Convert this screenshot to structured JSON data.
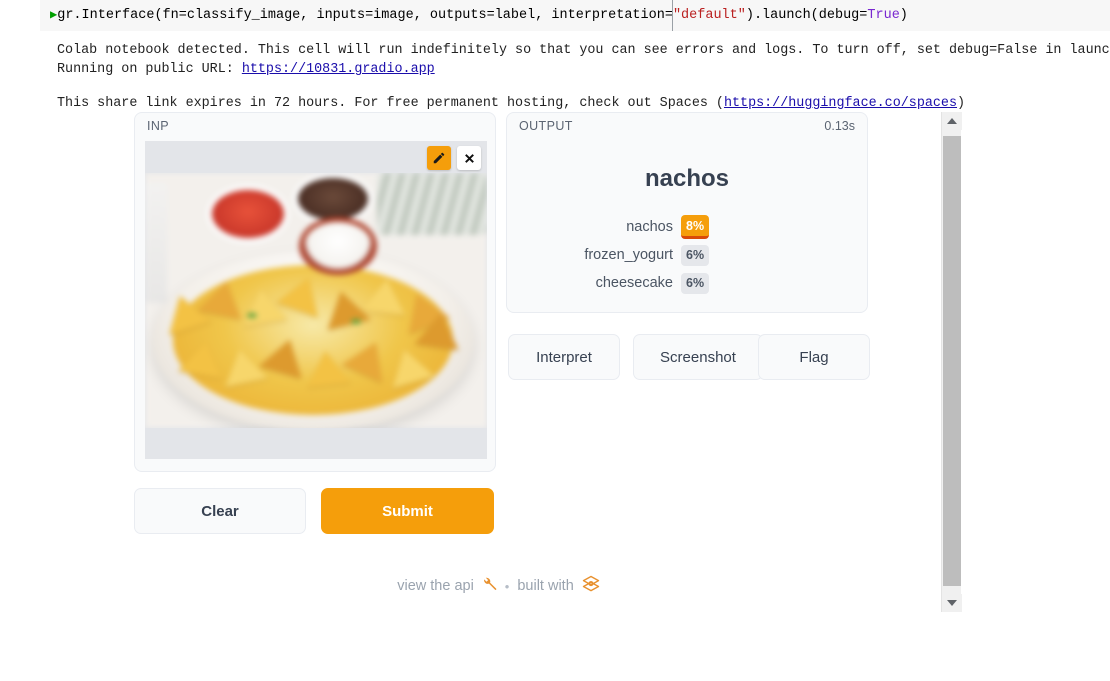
{
  "code_cell": {
    "run_caret": "▶",
    "text_parts": [
      {
        "t": "gr.Interface(fn=classify_image, inputs=image, outputs=label, interpretation=",
        "k": "plain"
      },
      {
        "t": "\"default\"",
        "k": "string"
      },
      {
        "t": ").launch(debug=",
        "k": "plain"
      },
      {
        "t": "True",
        "k": "keyword"
      },
      {
        "t": ")",
        "k": "plain"
      }
    ],
    "full_text": "gr.Interface(fn=classify_image, inputs=image, outputs=label, interpretation=\"default\").launch(debug=True)"
  },
  "log": {
    "line1": "Colab notebook detected. This cell will run indefinitely so that you can see errors and logs. To turn off, set debug=False in launch().",
    "line2_prefix": "Running on public URL: ",
    "public_url": "https://10831.gradio.app",
    "line3_prefix": "This share link expires in 72 hours. For free permanent hosting, check out Spaces (",
    "spaces_url": "https://huggingface.co/spaces",
    "line3_suffix": ")"
  },
  "gradio": {
    "input_panel": {
      "label": "INP",
      "edit_icon": "pencil-icon",
      "close_icon": "close-icon"
    },
    "output_panel": {
      "label": "OUTPUT",
      "duration": "0.13s",
      "top_label": "nachos",
      "predictions": [
        {
          "name": "nachos",
          "percent": "8%",
          "highlight": true
        },
        {
          "name": "frozen_yogurt",
          "percent": "6%",
          "highlight": false
        },
        {
          "name": "cheesecake",
          "percent": "6%",
          "highlight": false
        }
      ]
    },
    "buttons": {
      "interpret": "Interpret",
      "screenshot": "Screenshot",
      "flag": "Flag",
      "clear": "Clear",
      "submit": "Submit"
    },
    "footer": {
      "api_text": "view the api",
      "wrench_icon": "wrench-icon",
      "separator": "•",
      "built_with_text": "built with",
      "gradio_logo": "gradio-logo-icon"
    }
  },
  "scrollbar": {
    "up_icon": "scroll-up-arrow-icon",
    "down_icon": "scroll-down-arrow-icon",
    "thumb": "scroll-thumb"
  },
  "colors": {
    "accent_orange": "#f59e0b",
    "submit_orange": "#f59e0b",
    "bar_underline": "#d94a0a",
    "panel_bg": "#f9fafb",
    "panel_border": "#e9ecf1",
    "image_letterbox": "#e3e5e9",
    "link_blue": "#1a0dab",
    "code_string": "#ba2121",
    "code_keyword": "#7928d0",
    "footer_text": "#9aa3ae"
  }
}
